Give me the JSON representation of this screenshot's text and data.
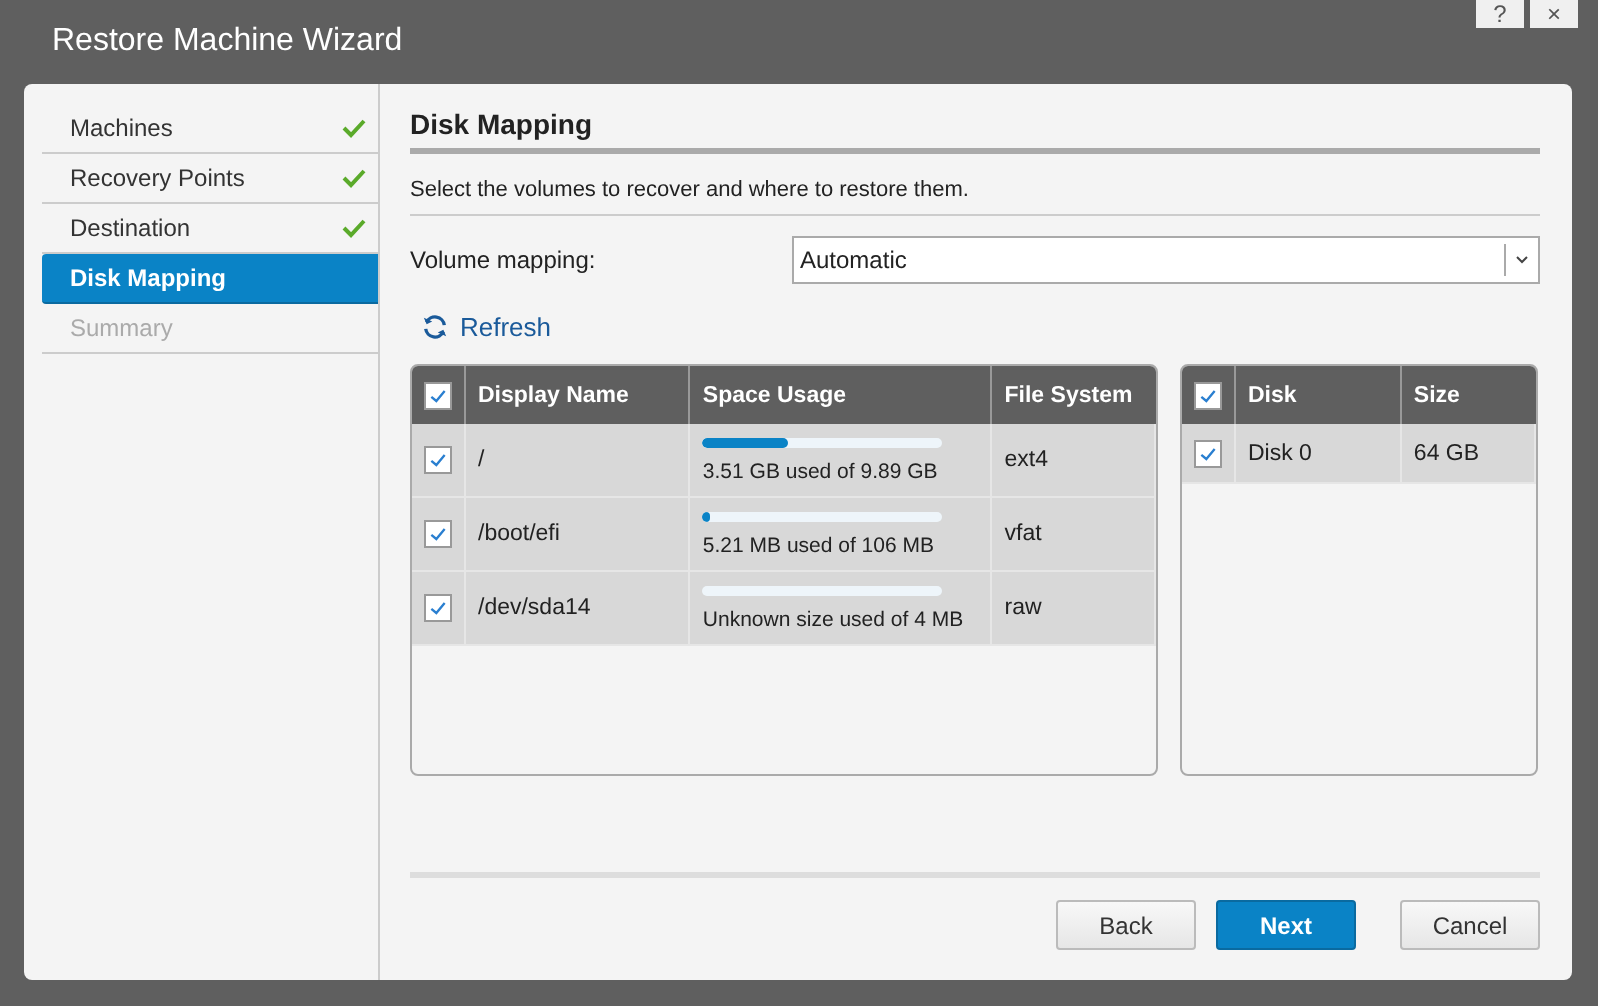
{
  "window": {
    "title": "Restore Machine Wizard",
    "help": "?",
    "close": "×"
  },
  "steps": [
    {
      "label": "Machines",
      "completed": true,
      "selected": false,
      "disabled": false
    },
    {
      "label": "Recovery Points",
      "completed": true,
      "selected": false,
      "disabled": false
    },
    {
      "label": "Destination",
      "completed": true,
      "selected": false,
      "disabled": false
    },
    {
      "label": "Disk Mapping",
      "completed": false,
      "selected": true,
      "disabled": false
    },
    {
      "label": "Summary",
      "completed": false,
      "selected": false,
      "disabled": true
    }
  ],
  "page": {
    "heading": "Disk Mapping",
    "description": "Select the volumes to recover and where to restore them.",
    "mapping_label": "Volume mapping:",
    "mapping_value": "Automatic",
    "refresh": "Refresh"
  },
  "volumes": {
    "all_checked": true,
    "columns": [
      "Display Name",
      "Space Usage",
      "File System"
    ],
    "rows": [
      {
        "checked": true,
        "name": "/",
        "level": 0.355,
        "usage": "3.51 GB used of 9.89 GB",
        "file_system": "ext4"
      },
      {
        "checked": true,
        "name": "/boot/efi",
        "level": 0.03,
        "usage": "5.21 MB used of 106 MB",
        "file_system": "vfat"
      },
      {
        "checked": true,
        "name": "/dev/sda14",
        "level": 0,
        "usage": "Unknown size used of 4 MB",
        "file_system": "raw"
      }
    ]
  },
  "disks": {
    "all_checked": true,
    "columns": [
      "Disk",
      "Size"
    ],
    "rows": [
      {
        "checked": true,
        "disk": "Disk 0",
        "size": "64 GB"
      }
    ]
  },
  "buttons": [
    {
      "label": "Back",
      "kind": "secondary"
    },
    {
      "label": "Next",
      "kind": "primary"
    },
    {
      "label": "Cancel",
      "kind": "cancel"
    }
  ]
}
